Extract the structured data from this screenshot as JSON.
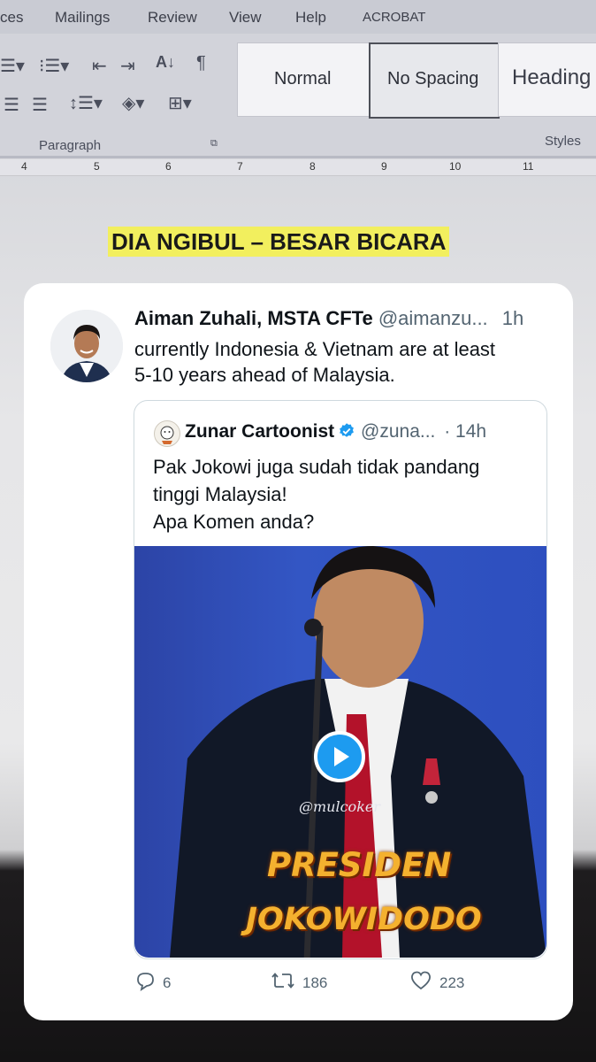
{
  "ribbon": {
    "tabs": [
      "ces",
      "Mailings",
      "Review",
      "View",
      "Help",
      "ACROBAT"
    ],
    "group_paragraph": "Paragraph",
    "group_styles": "Styles",
    "styles": [
      "Normal",
      "No Spacing",
      "Heading"
    ],
    "selected_style": "No Spacing"
  },
  "ruler": {
    "marks": [
      "4",
      "5",
      "6",
      "7",
      "8",
      "9",
      "10",
      "11"
    ]
  },
  "document": {
    "heading": "DIA NGIBUL – BESAR BICARA"
  },
  "tweet": {
    "author_name": "Aiman Zuhali, MSTA CFTe",
    "handle": "@aimanzu...",
    "time": "1h",
    "text": "currently Indonesia & Vietnam are at least\n5-10 years ahead of Malaysia.",
    "quoted": {
      "author_name": "Zunar Cartoonist",
      "handle": "@zuna...",
      "time": "· 14h",
      "text": "Pak Jokowi juga sudah tidak pandang\ntinggi Malaysia!\nApa Komen anda?",
      "video_watermark": "@mulcoker",
      "video_caption_line1": "PRESIDEN",
      "video_caption_line2": "JOKOWIDODO"
    },
    "stats": {
      "replies": "6",
      "retweets": "186",
      "likes": "223"
    }
  },
  "colors": {
    "accent": "#1d9bf0",
    "highlight": "#f2ef5e",
    "text_secondary": "#536471"
  },
  "icons": [
    "reply-icon",
    "retweet-icon",
    "like-icon",
    "verified-badge-icon",
    "play-icon"
  ]
}
